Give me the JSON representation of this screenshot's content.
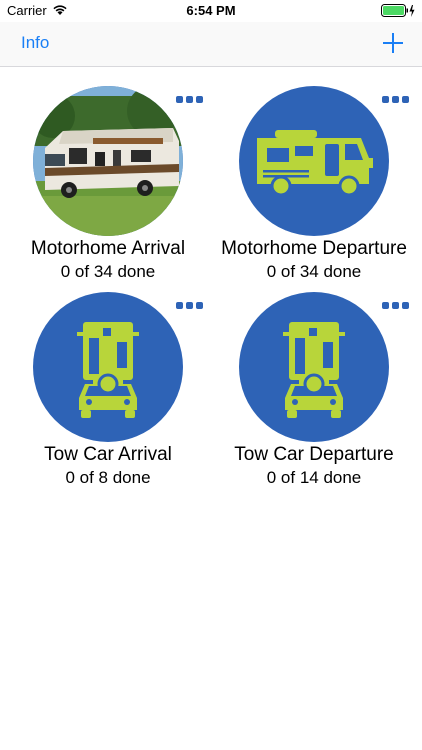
{
  "status": {
    "carrier": "Carrier",
    "time": "6:54 PM"
  },
  "nav": {
    "info_label": "Info"
  },
  "checklists": [
    {
      "title": "Motorhome Arrival",
      "progress": "0 of 34 done"
    },
    {
      "title": "Motorhome Departure",
      "progress": "0 of 34 done"
    },
    {
      "title": "Tow Car Arrival",
      "progress": "0 of 8 done"
    },
    {
      "title": "Tow Car Departure",
      "progress": "0 of 14 done"
    }
  ],
  "colors": {
    "accent_blue": "#2e63b6",
    "icon_green": "#b8d53a",
    "link_blue": "#1a7ff5"
  }
}
